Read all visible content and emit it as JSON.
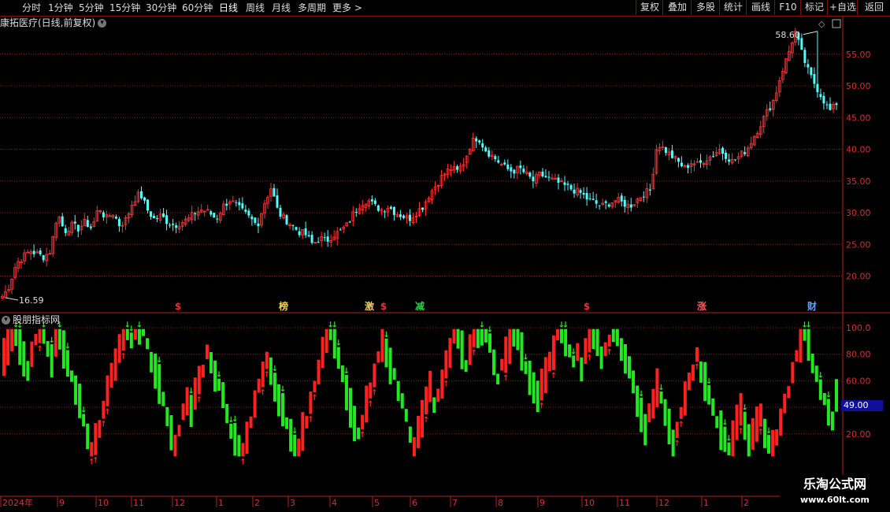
{
  "toolbar": {
    "periods": [
      "分时",
      "1分钟",
      "5分钟",
      "15分钟",
      "30分钟",
      "60分钟",
      "日线",
      "周线",
      "月线",
      "多周期",
      "更多 >"
    ],
    "active_period": "日线",
    "tools": [
      "复权",
      "叠加",
      "多股",
      "统计",
      "画线",
      "F10",
      "标记",
      "+自选",
      "返回"
    ]
  },
  "stock": {
    "name": "康拓医疗(日线,前复权)"
  },
  "price_chart": {
    "high_label": "58.60",
    "low_label": "16.59",
    "y_ticks": [
      "55.00",
      "50.00",
      "45.00",
      "40.00",
      "35.00",
      "30.00",
      "25.00",
      "20.00"
    ],
    "event_markers": [
      {
        "label": "$",
        "color": "#e83030"
      },
      {
        "label": "榜",
        "color": "#f0d060"
      },
      {
        "label": "激",
        "color": "#f0d060"
      },
      {
        "label": "$",
        "color": "#e83030"
      },
      {
        "label": "减",
        "color": "#30d040"
      },
      {
        "label": "$",
        "color": "#e83030"
      },
      {
        "label": "涨",
        "color": "#f06060"
      },
      {
        "label": "财",
        "color": "#60a0ff"
      }
    ]
  },
  "indicator": {
    "title": "股朋指标网",
    "current_value": "49.00",
    "y_ticks": [
      "100.0",
      "80.00",
      "60.00",
      "40.00",
      "20.00"
    ]
  },
  "x_axis": {
    "labels": [
      "2024年",
      "9",
      "10",
      "11",
      "12",
      "1",
      "2",
      "3",
      "4",
      "5",
      "6",
      "7",
      "8",
      "9",
      "10",
      "11",
      "12",
      "1",
      "2"
    ]
  },
  "watermark": {
    "line1": "乐淘公式网",
    "line2": "www.60lt.com"
  },
  "colors": {
    "up": "#ff3232",
    "down": "#54fcfc",
    "bull": "#ff2020",
    "bear": "#22e822",
    "grid": "#8b1a1a",
    "axis": "#b02020"
  },
  "chart_data": {
    "type": "candlestick",
    "title": "康拓医疗(日线,前复权)",
    "ylim": [
      15,
      60
    ],
    "high": 58.6,
    "low": 16.59,
    "price_path": [
      16.6,
      18.5,
      22,
      23,
      24,
      23.5,
      23,
      24,
      30,
      27,
      28,
      27.5,
      28.5,
      27.5,
      31,
      29,
      30,
      28,
      29,
      32,
      33,
      30.5,
      29,
      29.5,
      28.5,
      28,
      28.5,
      29,
      30,
      30.5,
      30,
      29,
      31,
      32,
      31,
      30,
      29,
      28,
      31.5,
      34,
      30,
      29,
      28,
      27,
      26.5,
      25,
      26,
      25.5,
      26.5,
      27,
      28,
      30,
      31.5,
      32,
      31,
      30.5,
      31,
      30,
      29.5,
      29,
      30,
      31,
      33,
      34.5,
      36,
      37,
      36.5,
      38,
      41,
      42,
      40,
      39,
      38,
      37,
      36.5,
      37,
      36,
      35,
      36,
      35.5,
      35,
      34.5,
      34,
      33.5,
      33,
      32,
      31.5,
      31,
      31.5,
      32,
      31.5,
      31,
      32,
      33,
      33.5,
      41,
      40,
      39,
      38,
      37,
      38,
      37.5,
      38.5,
      39,
      40,
      39,
      38,
      39,
      40,
      42,
      44,
      46,
      48,
      52,
      55,
      58.6,
      55,
      52,
      50,
      48,
      46,
      47
    ],
    "indicator": {
      "ylim": [
        0,
        100
      ],
      "last": 49.0
    }
  }
}
